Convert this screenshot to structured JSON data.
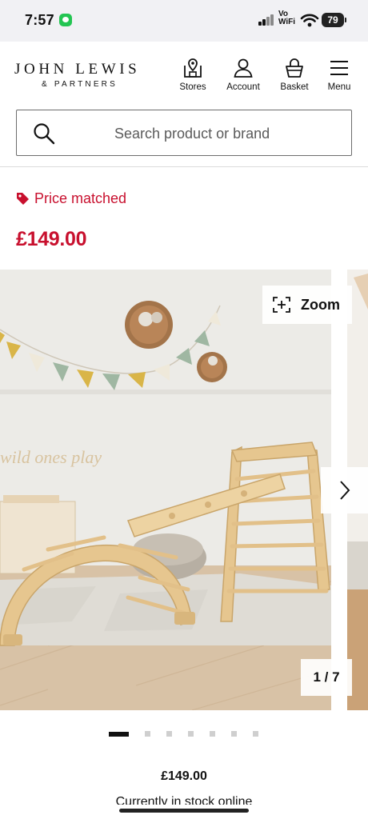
{
  "status_bar": {
    "time": "7:57",
    "network_label_top": "Vo",
    "network_label_bottom": "WiFi",
    "battery": "79"
  },
  "header": {
    "logo_main": "JOHN LEWIS",
    "logo_sub": "& PARTNERS",
    "nav": {
      "stores": "Stores",
      "account": "Account",
      "basket": "Basket",
      "menu": "Menu"
    }
  },
  "search": {
    "placeholder": "Search product or brand"
  },
  "product": {
    "price_matched_label": "Price matched",
    "price": "£149.00",
    "bottom_price": "£149.00",
    "stock_status": "Currently in stock online"
  },
  "gallery": {
    "zoom_label": "Zoom",
    "counter": "1 / 7",
    "image_wall_text": "wild ones play",
    "total_images": 7,
    "current_image": 1
  },
  "colors": {
    "brand_red": "#c8102e",
    "text": "#111111",
    "dot_inactive": "#cfcfcf"
  },
  "icons": [
    "stores-icon",
    "account-icon",
    "basket-icon",
    "menu-icon",
    "search-icon",
    "price-tag-icon",
    "zoom-icon",
    "chevron-right-icon"
  ]
}
